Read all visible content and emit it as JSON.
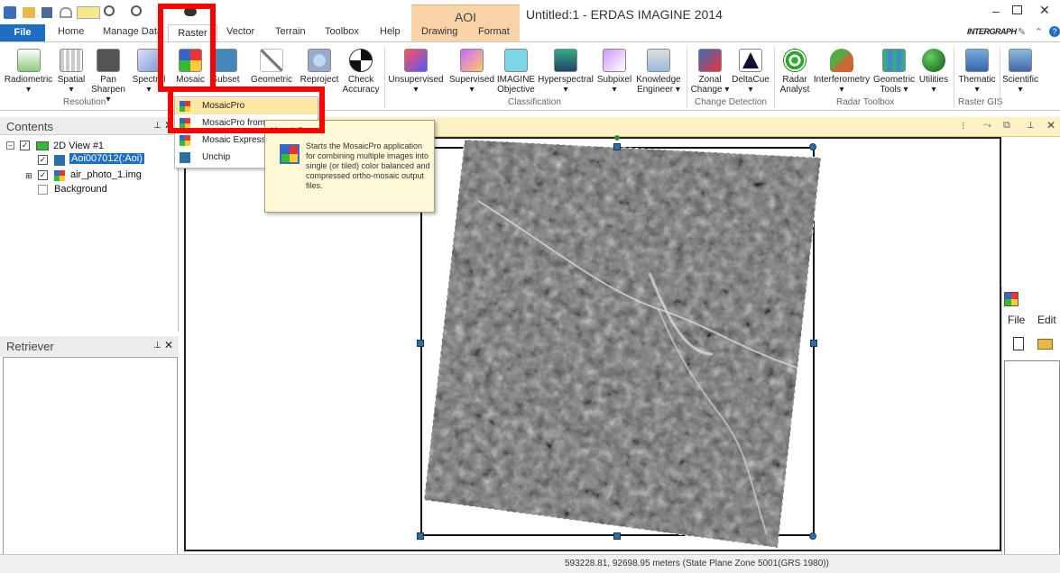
{
  "window": {
    "title": "Untitled:1 - ERDAS IMAGINE 2014",
    "context_tab": "AOI",
    "brand": "INTERGRAPH"
  },
  "tabs": [
    "File",
    "Home",
    "Manage Data",
    "Raster",
    "Vector",
    "Terrain",
    "Toolbox",
    "Help",
    "Drawing",
    "Format"
  ],
  "ribbon": {
    "resolution": {
      "label": "Resolution",
      "buttons": [
        {
          "label": "Radiometric",
          "caret": true
        },
        {
          "label": "Spatial",
          "caret": true
        },
        {
          "label": "Pan",
          "label2": "Sharpen ▾"
        },
        {
          "label": "Spectral",
          "caret": true
        }
      ]
    },
    "geometry": {
      "buttons": [
        {
          "label": "Mosaic"
        },
        {
          "label": "Subset"
        },
        {
          "label": "Geometric"
        },
        {
          "label": "Reproject"
        },
        {
          "label": "Check",
          "label2": "Accuracy"
        }
      ]
    },
    "classification": {
      "label": "Classification",
      "buttons": [
        {
          "label": "Unsupervised"
        },
        {
          "label": "Supervised"
        },
        {
          "label": "IMAGINE",
          "label2": "Objective"
        },
        {
          "label": "Hyperspectral"
        },
        {
          "label": "Subpixel"
        },
        {
          "label": "Knowledge",
          "label2": "Engineer ▾"
        }
      ]
    },
    "change_detection": {
      "label": "Change Detection",
      "buttons": [
        {
          "label": "Zonal",
          "label2": "Change ▾"
        },
        {
          "label": "DeltaCue",
          "caret": true
        }
      ]
    },
    "radar_toolbox": {
      "label": "Radar Toolbox",
      "buttons": [
        {
          "label": "Radar",
          "label2": "Analyst"
        },
        {
          "label": "Interferometry",
          "caret": true
        },
        {
          "label": "Geometric",
          "label2": "Tools ▾"
        },
        {
          "label": "Utilities",
          "caret": true
        }
      ]
    },
    "raster_gis": {
      "label": "Raster GIS",
      "buttons": [
        {
          "label": "Thematic",
          "caret": true
        }
      ]
    },
    "scientific": {
      "buttons": [
        {
          "label": "Scientific",
          "caret": true
        }
      ]
    }
  },
  "mosaic_menu": {
    "items": [
      "MosaicPro",
      "MosaicPro from",
      "Mosaic Express",
      "Unchip"
    ]
  },
  "tooltip": {
    "title": "MosaicPro",
    "text": "Starts the MosaicPro application for combining multiple images into single (or tiled) color balanced and compressed ortho-mosaic output files."
  },
  "contents": {
    "title": "Contents",
    "view": "2D View #1",
    "layers": [
      "Aoi007012(:Aoi)",
      "air_photo_1.img",
      "Background"
    ]
  },
  "retriever": {
    "title": "Retriever"
  },
  "status": {
    "coordinates": "593228.81, 92698.95 meters (State Plane Zone 5001(GRS 1980))"
  },
  "mini_window": {
    "menu": [
      "File",
      "Edit"
    ]
  },
  "colors": {
    "accent": "#1e6fc2",
    "highlight": "#ff0000",
    "aoi_tab": "#f9d2a8"
  }
}
